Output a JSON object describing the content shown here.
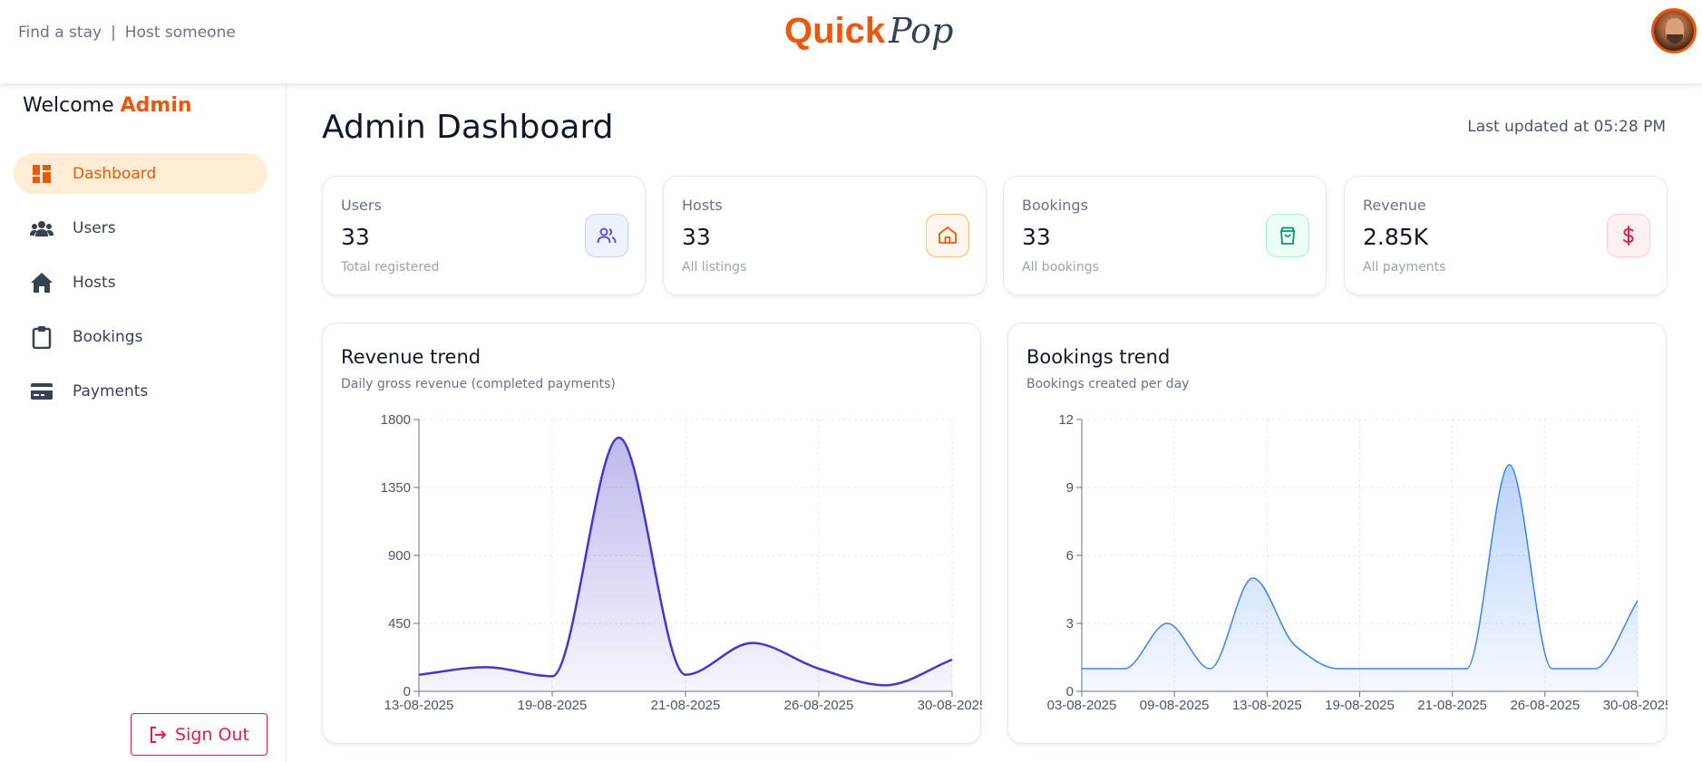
{
  "header": {
    "links": [
      "Find a stay",
      "Host someone"
    ],
    "separator": "|",
    "brand_quick": "Quick",
    "brand_pop": "Pop",
    "brand_color": "#ea580c"
  },
  "sidebar": {
    "welcome_prefix": "Welcome",
    "welcome_name": "Admin",
    "items": [
      {
        "label": "Dashboard",
        "icon": "dashboard-icon",
        "active": true
      },
      {
        "label": "Users",
        "icon": "users-icon",
        "active": false
      },
      {
        "label": "Hosts",
        "icon": "home-icon",
        "active": false
      },
      {
        "label": "Bookings",
        "icon": "clipboard-icon",
        "active": false
      },
      {
        "label": "Payments",
        "icon": "credit-card-icon",
        "active": false
      }
    ],
    "signout_label": "Sign Out"
  },
  "main": {
    "title": "Admin Dashboard",
    "last_updated": "Last updated at 05:28 PM",
    "stats": [
      {
        "label": "Users",
        "value": "33",
        "sub": "Total registered",
        "icon": "users-outline-icon",
        "color": "#4f46e5"
      },
      {
        "label": "Hosts",
        "value": "33",
        "sub": "All listings",
        "icon": "house-outline-icon",
        "color": "#ea580c"
      },
      {
        "label": "Bookings",
        "value": "33",
        "sub": "All bookings",
        "icon": "shopping-bag-icon",
        "color": "#059669"
      },
      {
        "label": "Revenue",
        "value": "2.85K",
        "sub": "All payments",
        "icon": "dollar-icon",
        "color": "#e11d48"
      }
    ]
  },
  "chart_data": [
    {
      "type": "area",
      "title": "Revenue trend",
      "subtitle": "Daily gross revenue (completed payments)",
      "x": [
        "13-08-2025",
        "",
        "19-08-2025",
        "",
        "21-08-2025",
        "",
        "26-08-2025",
        "30-08-2025",
        ""
      ],
      "x_tick_labels": [
        "13-08-2025",
        "19-08-2025",
        "21-08-2025",
        "26-08-2025",
        "30-08-2025"
      ],
      "values": [
        110,
        160,
        100,
        1680,
        110,
        320,
        150,
        40,
        210
      ],
      "ylim": [
        0,
        1800
      ],
      "yticks": [
        0,
        450,
        900,
        1350,
        1800
      ],
      "color": "#4338ca",
      "grid": true
    },
    {
      "type": "area",
      "title": "Bookings trend",
      "subtitle": "Bookings created per day",
      "x": [
        "03-08-2025",
        "",
        "09-08-2025",
        "",
        "13-08-2025",
        "",
        "19-08-2025",
        "21-08-2025",
        "",
        "26-08-2025",
        "",
        "30-08-2025",
        ""
      ],
      "x_tick_labels": [
        "03-08-2025",
        "09-08-2025",
        "13-08-2025",
        "19-08-2025",
        "21-08-2025",
        "26-08-2025",
        "30-08-2025"
      ],
      "values": [
        1,
        1,
        3,
        1,
        5,
        2,
        1,
        1,
        1,
        1,
        10,
        1,
        1,
        4
      ],
      "ylim": [
        0,
        12
      ],
      "yticks": [
        0,
        3,
        6,
        9,
        12
      ],
      "color": "#3b82f6",
      "grid": true
    }
  ]
}
